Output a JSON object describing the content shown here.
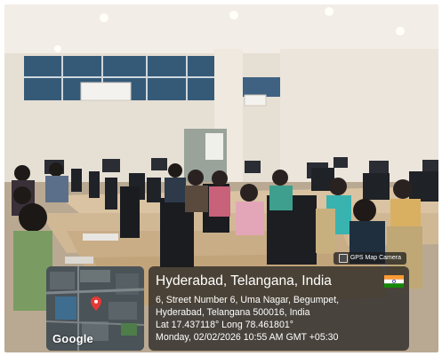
{
  "gps_badge": {
    "label": "GPS Map Camera",
    "icon": "camera-icon"
  },
  "map": {
    "logo_text": "Google",
    "pin_color": "#e53935"
  },
  "location": {
    "title": "Hyderabad, Telangana, India",
    "address_line1": "6, Street Number 6, Uma Nagar, Begumpet,",
    "address_line2": "Hyderabad, Telangana 500016, India",
    "coordinates": "Lat 17.437118° Long 78.461801°",
    "timestamp": "Monday, 02/02/2026 10:55 AM GMT +05:30",
    "flag": "india-flag-icon"
  }
}
